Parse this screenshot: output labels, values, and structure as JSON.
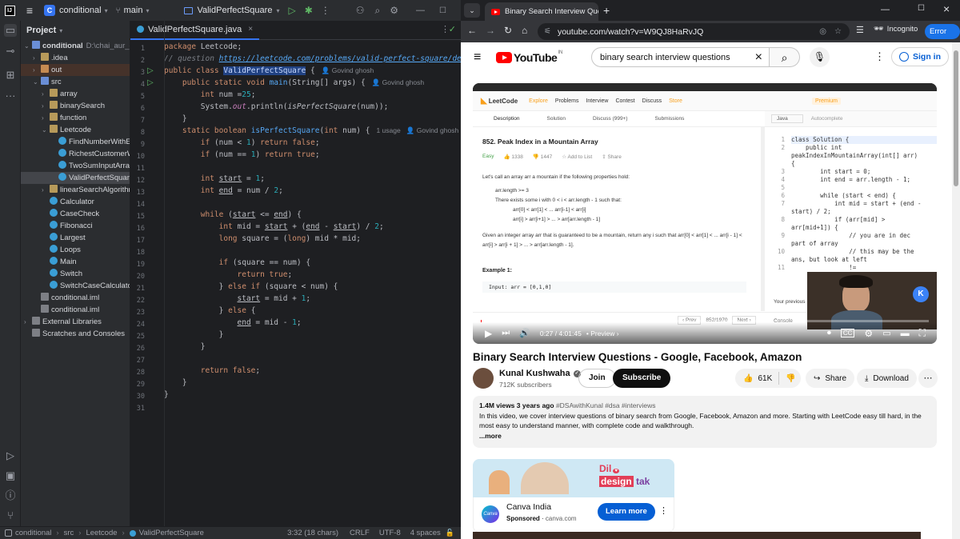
{
  "ide": {
    "project_name": "conditional",
    "branch": "main",
    "run_config": "ValidPerfectSquare",
    "panel_title": "Project",
    "tab_label": "ValidPerfectSquare.java",
    "tree": [
      {
        "label": "conditional",
        "extra": "D:\\chai_aur_code",
        "depth": 0,
        "type": "folder-blue",
        "open": true
      },
      {
        "label": ".idea",
        "depth": 1,
        "type": "folder",
        "open": false
      },
      {
        "label": "out",
        "depth": 1,
        "type": "folder-orange",
        "open": false
      },
      {
        "label": "src",
        "depth": 1,
        "type": "folder-blue",
        "open": true
      },
      {
        "label": "array",
        "depth": 2,
        "type": "folder",
        "open": false
      },
      {
        "label": "binarySearch",
        "depth": 2,
        "type": "folder",
        "open": false
      },
      {
        "label": "function",
        "depth": 2,
        "type": "folder",
        "open": false
      },
      {
        "label": "Leetcode",
        "depth": 2,
        "type": "folder",
        "open": true
      },
      {
        "label": "FindNumberWithEvenNumberOfDigits",
        "depth": 3,
        "type": "class"
      },
      {
        "label": "RichestCustomerWealth",
        "depth": 3,
        "type": "class"
      },
      {
        "label": "TwoSumInputArray",
        "depth": 3,
        "type": "class"
      },
      {
        "label": "ValidPerfectSquare",
        "depth": 3,
        "type": "class",
        "selected": true
      },
      {
        "label": "linearSearchAlgorithm",
        "depth": 2,
        "type": "folder",
        "open": false
      },
      {
        "label": "Calculator",
        "depth": 2,
        "type": "class"
      },
      {
        "label": "CaseCheck",
        "depth": 2,
        "type": "class"
      },
      {
        "label": "Fibonacci",
        "depth": 2,
        "type": "class"
      },
      {
        "label": "Largest",
        "depth": 2,
        "type": "class"
      },
      {
        "label": "Loops",
        "depth": 2,
        "type": "class"
      },
      {
        "label": "Main",
        "depth": 2,
        "type": "class"
      },
      {
        "label": "Switch",
        "depth": 2,
        "type": "class"
      },
      {
        "label": "SwitchCaseCalculator",
        "depth": 2,
        "type": "class"
      },
      {
        "label": "conditional.iml",
        "depth": 1,
        "type": "iml"
      },
      {
        "label": "conditional.iml",
        "depth": 1,
        "type": "iml"
      },
      {
        "label": "External Libraries",
        "depth": 0,
        "type": "lib",
        "open": false
      },
      {
        "label": "Scratches and Consoles",
        "depth": 0,
        "type": "scratch"
      }
    ],
    "code": [
      "<span class=\"kw\">package</span> Leetcode;",
      "<span class=\"cm\">// question <span class=\"lnk\">https://leetcode.com/problems/valid-perfect-square/descript</span></span>",
      "<span class=\"kw\">public class</span> <span class=\"selword\">ValidPerfectSquare</span> {<span class=\"hint\">&#x1F464; Govind ghosh</span>",
      "    <span class=\"kw\">public static void</span> <span class=\"fn\">main</span>(String[] args) {<span class=\"hint\">&#x1F464; Govind ghosh</span>",
      "        <span class=\"kw\">int</span> num =<span class=\"num\">25</span>;",
      "        System.<span class=\"purple ital\">out</span>.println(<span class=\"ital\">isPerfectSquare</span>(num));",
      "    }",
      "    <span class=\"kw\">static boolean</span> <span class=\"fn\">isPerfectSquare</span>(<span class=\"kw\">int</span> num) {<span class=\"hint\">1 usage &nbsp; &#x1F464; Govind ghosh</span>",
      "        <span class=\"kw\">if</span> (num &lt; <span class=\"num\">1</span>) <span class=\"kw\">return false</span>;",
      "        <span class=\"kw\">if</span> (num == <span class=\"num\">1</span>) <span class=\"kw\">return true</span>;",
      "",
      "        <span class=\"kw\">int</span> <u>start</u> = <span class=\"num\">1</span>;",
      "        <span class=\"kw\">int</span> <u>end</u> = num / <span class=\"num\">2</span>;",
      "",
      "        <span class=\"kw\">while</span> (<u>start</u> &lt;= <u>end</u>) {",
      "            <span class=\"kw\">int</span> mid = <u>start</u> + (<u>end</u> - <u>start</u>) / <span class=\"num\">2</span>;",
      "            <span class=\"kw\">long</span> square = (<span class=\"kw\">long</span>) mid * mid;",
      "",
      "            <span class=\"kw\">if</span> (square == num) {",
      "                <span class=\"kw\">return true</span>;",
      "            } <span class=\"kw\">else if</span> (square &lt; num) {",
      "                <u>start</u> = mid + <span class=\"num\">1</span>;",
      "            } <span class=\"kw\">else</span> {",
      "                <u>end</u> = mid - <span class=\"num\">1</span>;",
      "            }",
      "        }",
      "",
      "        <span class=\"kw\">return false</span>;",
      "    }",
      "}",
      ""
    ],
    "status": {
      "crumbs": [
        "conditional",
        "src",
        "Leetcode",
        "ValidPerfectSquare"
      ],
      "position": "3:32 (18 chars)",
      "line_sep": "CRLF",
      "encoding": "UTF-8",
      "indent": "4 spaces"
    }
  },
  "browser": {
    "tab_title": "Binary Search Interview Questio",
    "url": "youtube.com/watch?v=W9QJ8HaRvJQ",
    "incognito": "Incognito",
    "error": "Error"
  },
  "youtube": {
    "search": "binary search interview questions",
    "sign_in": "Sign in",
    "logo_text": "YouTube",
    "region": "IN",
    "video": {
      "time": "0:27 / 4:01:45",
      "chapter": "Preview",
      "lc": {
        "nav": [
          "Explore",
          "Problems",
          "Interview",
          "Contest",
          "Discuss",
          "Store"
        ],
        "premium": "Premium",
        "tabs": [
          "Description",
          "Solution",
          "Discuss (999+)",
          "Submissions"
        ],
        "lang": "Java",
        "autocomplete": "Autocomplete",
        "problem_title": "852. Peak Index in a Mountain Array",
        "difficulty": "Easy",
        "likes": "1338",
        "dislikes": "1447",
        "add_list": "Add to List",
        "share": "Share",
        "intro": "Let's call an array arr a mountain if the following properties hold:",
        "bullets": [
          "arr.length >= 3",
          "There exists some i with 0 < i < arr.length - 1 such that:",
          "arr[0] < arr[1] < ... arr[i-1] < arr[i]",
          "arr[i] > arr[i+1] > ... > arr[arr.length - 1]"
        ],
        "given": "Given an integer array arr that is guaranteed to be a mountain, return any i such that arr[0] < arr[1] < ... arr[i - 1] < arr[i] > arr[i + 1] > ... > arr[arr.length - 1].",
        "example": "Example 1:",
        "example_input": "Input: arr = [0,1,0]",
        "pager": "852/1970",
        "prev": "Prev",
        "next": "Next",
        "console": "Console",
        "your_prev": "Your previous",
        "code_lines": [
          "class Solution {",
          "    public int",
          "peakIndexInMountainArray(int[] arr)",
          "{",
          "        int start = 0;",
          "        int end = arr.length - 1;",
          "",
          "        while (start < end) {",
          "            int mid = start + (end -",
          "start) / 2;",
          "            if (arr[mid] >",
          "arr[mid+1]) {",
          "                // you are in dec",
          "part of array",
          "                // this may be the",
          "ans, but look at left",
          "                !="
        ],
        "code_nums": [
          "1",
          "2",
          "",
          "",
          "3",
          "4",
          "5",
          "6",
          "7",
          "",
          "8",
          "",
          "9",
          "",
          "10",
          "",
          "11"
        ]
      }
    },
    "title": "Binary Search Interview Questions - Google, Facebook, Amazon",
    "channel": "Kunal Kushwaha",
    "subscribers": "712K subscribers",
    "join": "Join",
    "subscribe": "Subscribe",
    "likes": "61K",
    "share": "Share",
    "download": "Download",
    "views_meta": "1.4M views  3 years ago",
    "hashtags": "#DSAwithKunal #dsa #interviews",
    "description": "In this video, we cover interview questions of binary search from Google, Facebook, Amazon and more. Starting with LeetCode easy till hard, in the most easy to understand manner, with complete code and walkthrough.",
    "more": "...more",
    "ad": {
      "banner_text_1": "Dil",
      "banner_text_2": "design",
      "banner_text_3": "tak",
      "brand": "Canva India",
      "sponsored": "Sponsored",
      "domain": "canva.com",
      "cta": "Learn more",
      "logo": "Canva"
    }
  },
  "colors": {
    "ide_bg": "#1e1f22",
    "ide_panel": "#2b2d30",
    "accent": "#3574f0",
    "yt_red": "#ff0000",
    "error_badge": "#1a73e8"
  }
}
